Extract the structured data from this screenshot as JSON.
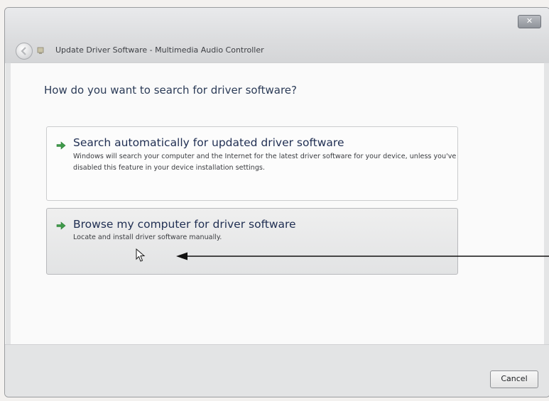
{
  "window": {
    "title": "Update Driver Software - Multimedia Audio Controller",
    "close_label": "✕"
  },
  "main": {
    "heading": "How do you want to search for driver software?",
    "options": [
      {
        "title": "Search automatically for updated driver software",
        "description": "Windows will search your computer and the Internet for the latest driver software for your device, unless you've disabled this feature in your device installation settings."
      },
      {
        "title": "Browse my computer for driver software",
        "description": "Locate and install driver software manually."
      }
    ]
  },
  "footer": {
    "cancel_label": "Cancel"
  },
  "icons": {
    "back": "back-arrow-icon",
    "app": "device-icon",
    "option_arrow": "green-arrow-icon",
    "cursor": "mouse-cursor-icon"
  },
  "colors": {
    "heading": "#2b3b57",
    "option_title": "#1f2e52",
    "option_arrow": "#3f9b4a"
  }
}
